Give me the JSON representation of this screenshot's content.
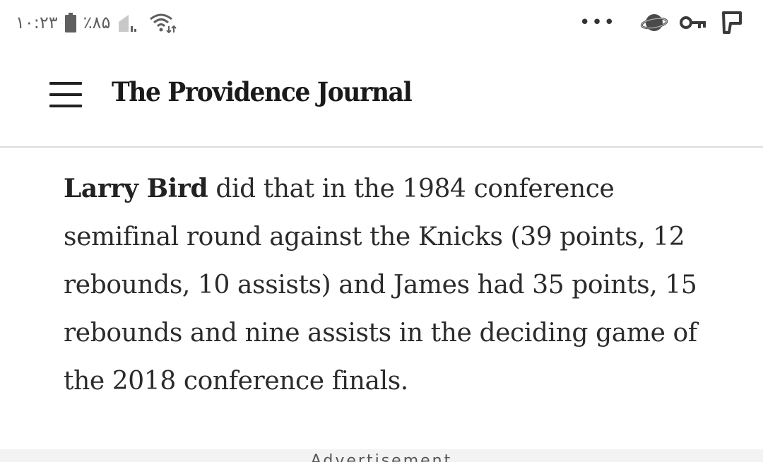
{
  "status_bar": {
    "time": "۱۰:۲۳",
    "battery_percent": "٪۸۵",
    "left_icons": [
      "battery-icon",
      "signal-icon",
      "wifi-icon"
    ],
    "overflow": "•••",
    "right_icons": [
      "planet-icon",
      "key-icon",
      "p-app-icon"
    ]
  },
  "header": {
    "logo_text": "The Providence Journal",
    "menu_icon": "hamburger-menu-icon"
  },
  "article": {
    "lead_name": "Larry Bird",
    "paragraph_rest": " did that in the 1984 conference semifinal round against the Knicks (39 points, 12 rebounds, 10 assists) and James had 35 points, 15 rebounds and nine assists in the deciding game of the 2018 conference finals."
  },
  "ad": {
    "label": "Advertisement"
  },
  "colors": {
    "text": "#2b2b2b",
    "divider": "#dcdcdc",
    "ad_background": "#f3f3f3"
  }
}
